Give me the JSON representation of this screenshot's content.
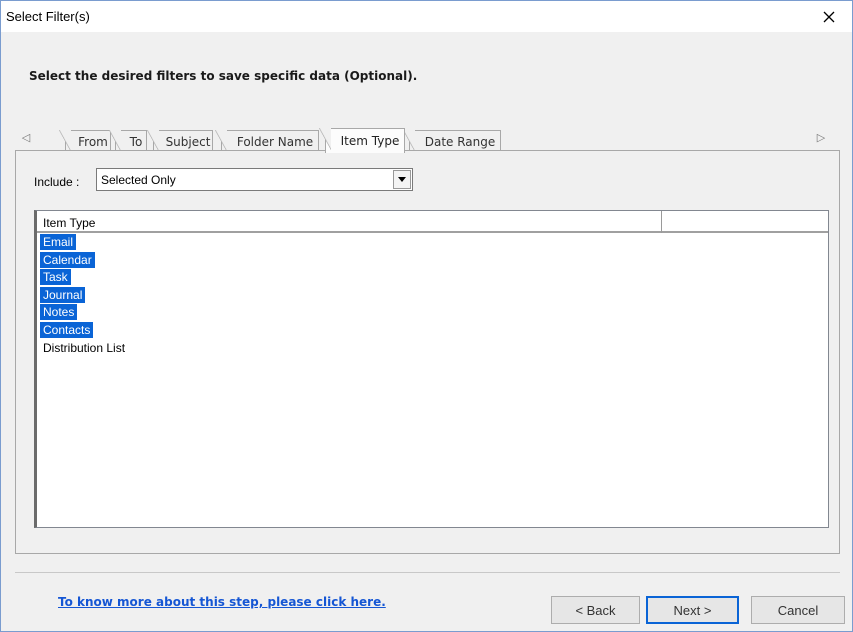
{
  "window": {
    "title": "Select Filter(s)"
  },
  "header": {
    "instruction": "Select the desired filters to save specific data (Optional)."
  },
  "tabs": [
    {
      "label": "From"
    },
    {
      "label": "To"
    },
    {
      "label": "Subject"
    },
    {
      "label": "Folder Name"
    },
    {
      "label": "Item Type",
      "active": true
    },
    {
      "label": "Date Range"
    }
  ],
  "include": {
    "label": "Include :",
    "value": "Selected Only"
  },
  "list": {
    "column": "Item Type",
    "items": [
      {
        "label": "Email",
        "selected": true
      },
      {
        "label": "Calendar",
        "selected": true
      },
      {
        "label": "Task",
        "selected": true
      },
      {
        "label": "Journal",
        "selected": true
      },
      {
        "label": "Notes",
        "selected": true
      },
      {
        "label": "Contacts",
        "selected": true
      },
      {
        "label": "Distribution List",
        "selected": false
      }
    ]
  },
  "footer": {
    "help_link": "To know more about this step, please click here.",
    "back": "< Back",
    "next": "Next >",
    "cancel": "Cancel"
  },
  "colors": {
    "selection": "#0a64d6",
    "link": "#1556d4"
  }
}
